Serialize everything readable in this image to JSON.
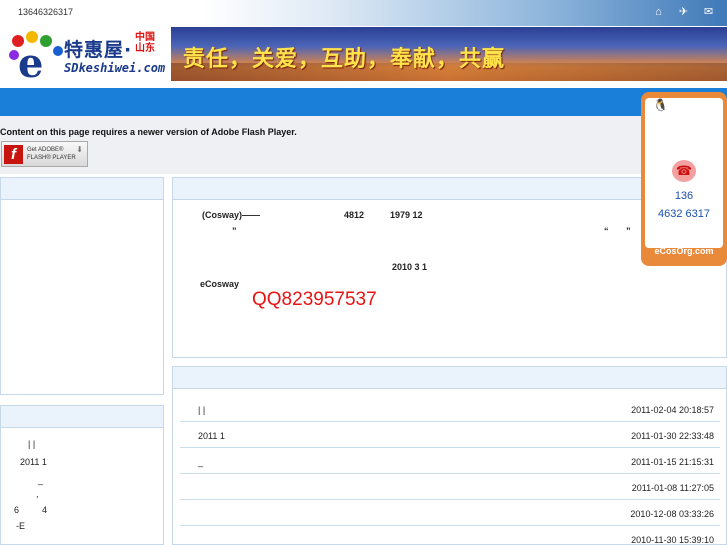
{
  "header": {
    "phone": "13646326317",
    "icons": [
      "home-icon",
      "bird-icon",
      "mail-icon"
    ],
    "logo": {
      "brand": "特惠屋·",
      "region": "中国山东",
      "domain": "SDkeshiwei.com"
    },
    "banner_slogan": "责任，关爱，互助，奉献，共赢"
  },
  "flash": {
    "message": "Content on this page requires a newer version of Adobe Flash Player.",
    "button_line1": "Get ADOBE®",
    "button_line2": "FLASH® PLAYER"
  },
  "main": {
    "line1_a": "(Cosway)——",
    "line1_b": "4812",
    "line1_c": "1979  12",
    "line2_a": "”",
    "line2_b": "“",
    "line2_c": "”",
    "line3": "2010  3  1",
    "line4": "eCosway",
    "qq": "QQ823957537"
  },
  "left_panel2": {
    "l1": "|     |",
    "l2": "2011 1",
    "l3": "_",
    "l4": ",",
    "l5a": "6",
    "l5b": "4",
    "l6": "-E"
  },
  "news_list": [
    {
      "title": "|     |",
      "date": "2011-02-04 20:18:57"
    },
    {
      "title": "2011 1",
      "date": "2011-01-30 22:33:48"
    },
    {
      "title": "_",
      "date": "2011-01-15 21:15:31"
    },
    {
      "title": "",
      "date": "2011-01-08 11:27:05"
    },
    {
      "title": "",
      "date": "2010-12-08 03:33:26"
    },
    {
      "title": "",
      "date": "2010-11-30 15:39:10"
    }
  ],
  "qq_float": {
    "tel_line1": "136",
    "tel_line2": "4632 6317",
    "site": "eCosOrg.com"
  },
  "colors": {
    "nav_blue": "#1a7fd8",
    "panel_border": "#c7d8ea",
    "accent_red": "#e81414",
    "float_orange": "#e98a3a"
  }
}
